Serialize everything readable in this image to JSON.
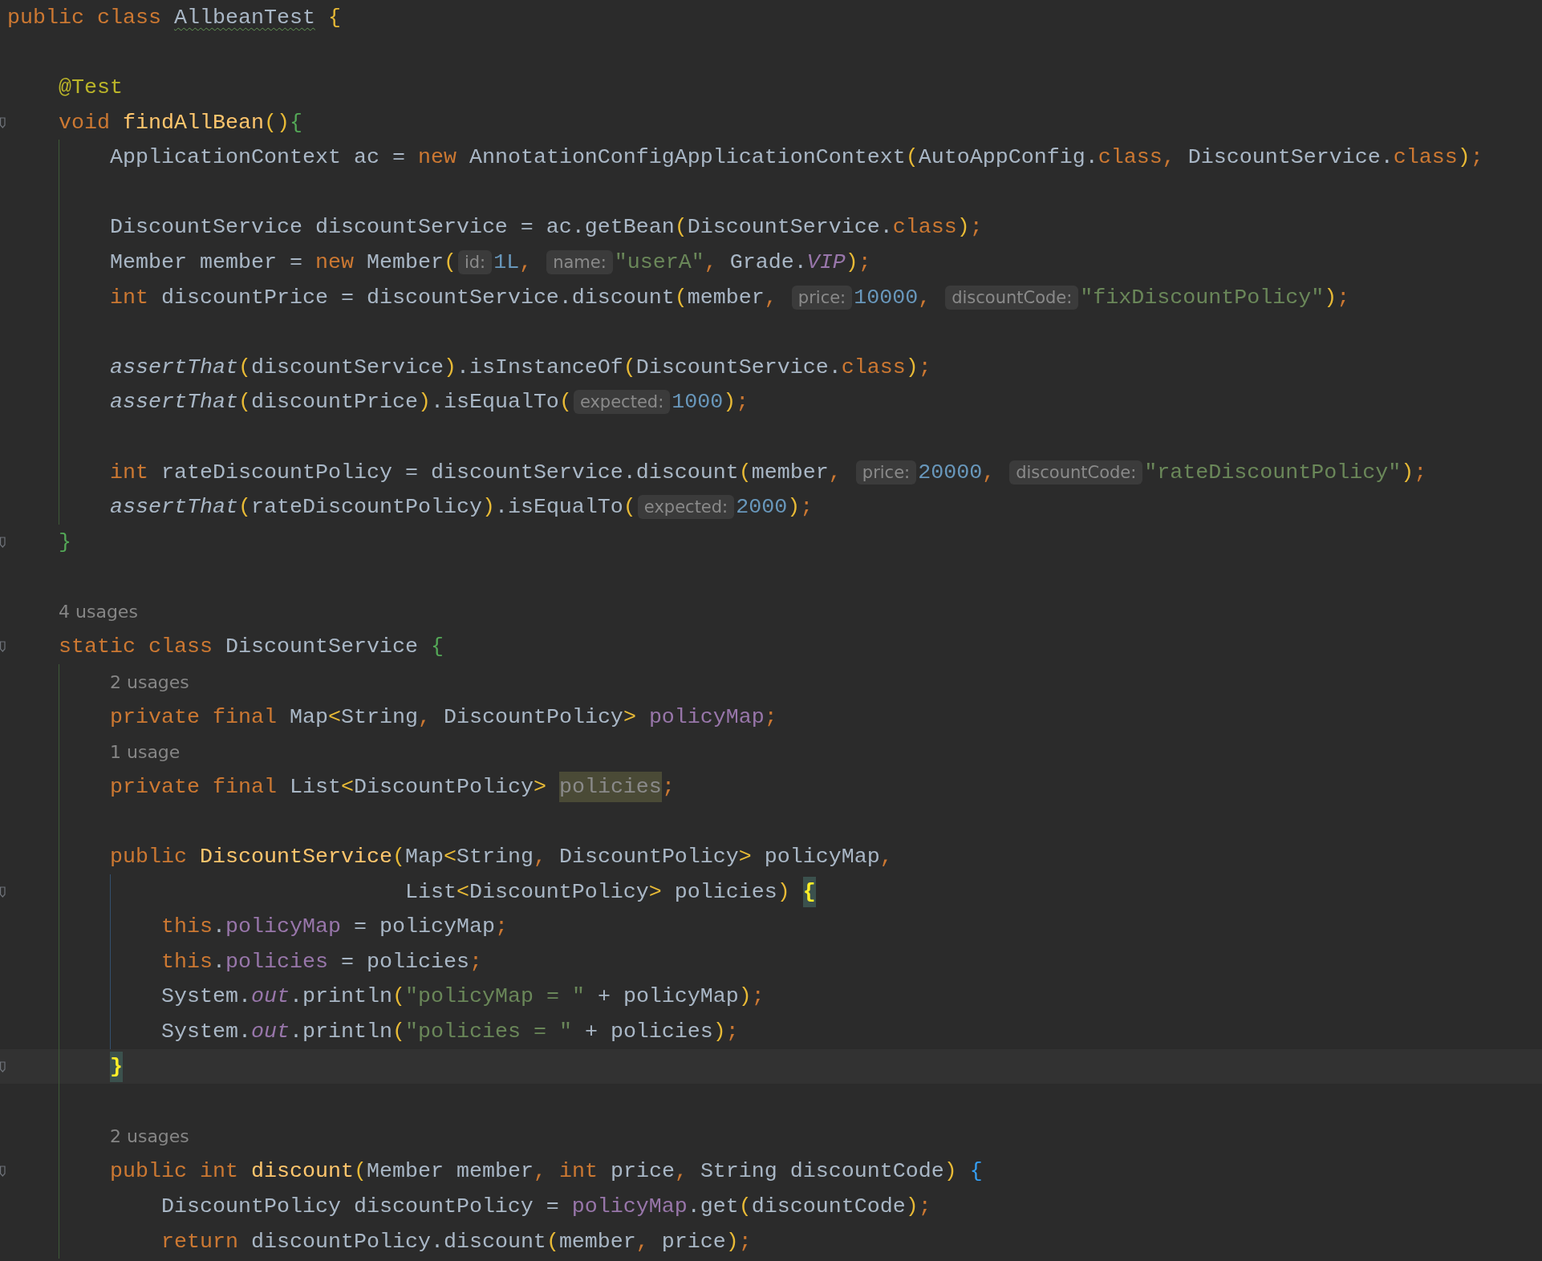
{
  "editor": {
    "lines": [
      {
        "kind": "code",
        "tokens": [
          {
            "text": "public class ",
            "kind": "kw"
          },
          {
            "text": "AllbeanTest",
            "kind": "typo"
          },
          {
            "text": " {",
            "kind": "p1"
          }
        ]
      },
      {
        "kind": "blank"
      },
      {
        "kind": "code",
        "tokens": [
          {
            "text": "    @Test",
            "kind": "ann"
          }
        ]
      },
      {
        "kind": "code",
        "fold": true,
        "tokens": [
          {
            "text": "    void ",
            "kind": "kw"
          },
          {
            "text": "findAllBean",
            "kind": "decl"
          },
          {
            "text": "()",
            "kind": "p1"
          },
          {
            "text": "{",
            "kind": "p2"
          }
        ]
      },
      {
        "kind": "code",
        "tokens": [
          {
            "text": "        ApplicationContext ac = ",
            "kind": "plain"
          },
          {
            "text": "new ",
            "kind": "kw"
          },
          {
            "text": "AnnotationConfigApplicationContext",
            "kind": "plain"
          },
          {
            "text": "(",
            "kind": "p1"
          },
          {
            "text": "AutoAppConfig.",
            "kind": "plain"
          },
          {
            "text": "class",
            "kind": "kw"
          },
          {
            "text": ", ",
            "kind": "punct"
          },
          {
            "text": "DiscountService.",
            "kind": "plain"
          },
          {
            "text": "class",
            "kind": "kw"
          },
          {
            "text": ")",
            "kind": "p1"
          },
          {
            "text": ";",
            "kind": "punct"
          }
        ]
      },
      {
        "kind": "blank"
      },
      {
        "kind": "code",
        "tokens": [
          {
            "text": "        DiscountService discountService = ac.getBean",
            "kind": "plain"
          },
          {
            "text": "(",
            "kind": "p1"
          },
          {
            "text": "DiscountService.",
            "kind": "plain"
          },
          {
            "text": "class",
            "kind": "kw"
          },
          {
            "text": ")",
            "kind": "p1"
          },
          {
            "text": ";",
            "kind": "punct"
          }
        ]
      },
      {
        "kind": "code",
        "tokens": [
          {
            "text": "        Member member = ",
            "kind": "plain"
          },
          {
            "text": "new ",
            "kind": "kw"
          },
          {
            "text": "Member",
            "kind": "plain"
          },
          {
            "text": "(",
            "kind": "p1"
          },
          {
            "text": "id:",
            "kind": "hint"
          },
          {
            "text": "1L",
            "kind": "num"
          },
          {
            "text": ", ",
            "kind": "punct"
          },
          {
            "text": "name:",
            "kind": "hint"
          },
          {
            "text": "\"userA\"",
            "kind": "str"
          },
          {
            "text": ", ",
            "kind": "punct"
          },
          {
            "text": "Grade.",
            "kind": "plain"
          },
          {
            "text": "VIP",
            "kind": "static"
          },
          {
            "text": ")",
            "kind": "p1"
          },
          {
            "text": ";",
            "kind": "punct"
          }
        ]
      },
      {
        "kind": "code",
        "tokens": [
          {
            "text": "        int ",
            "kind": "kw"
          },
          {
            "text": "discountPrice = discountService.discount",
            "kind": "plain"
          },
          {
            "text": "(",
            "kind": "p1"
          },
          {
            "text": "member",
            "kind": "plain"
          },
          {
            "text": ", ",
            "kind": "punct"
          },
          {
            "text": "price:",
            "kind": "hint"
          },
          {
            "text": "10000",
            "kind": "num"
          },
          {
            "text": ", ",
            "kind": "punct"
          },
          {
            "text": "discountCode:",
            "kind": "hint"
          },
          {
            "text": "\"fixDiscountPolicy\"",
            "kind": "str"
          },
          {
            "text": ")",
            "kind": "p1"
          },
          {
            "text": ";",
            "kind": "punct"
          }
        ]
      },
      {
        "kind": "blank"
      },
      {
        "kind": "code",
        "tokens": [
          {
            "text": "        assertThat",
            "kind": "ital"
          },
          {
            "text": "(",
            "kind": "p1"
          },
          {
            "text": "discountService",
            "kind": "plain"
          },
          {
            "text": ")",
            "kind": "p1"
          },
          {
            "text": ".isInstanceOf",
            "kind": "plain"
          },
          {
            "text": "(",
            "kind": "p1"
          },
          {
            "text": "DiscountService.",
            "kind": "plain"
          },
          {
            "text": "class",
            "kind": "kw"
          },
          {
            "text": ")",
            "kind": "p1"
          },
          {
            "text": ";",
            "kind": "punct"
          }
        ]
      },
      {
        "kind": "code",
        "tokens": [
          {
            "text": "        assertThat",
            "kind": "ital"
          },
          {
            "text": "(",
            "kind": "p1"
          },
          {
            "text": "discountPrice",
            "kind": "plain"
          },
          {
            "text": ")",
            "kind": "p1"
          },
          {
            "text": ".isEqualTo",
            "kind": "plain"
          },
          {
            "text": "(",
            "kind": "p1"
          },
          {
            "text": "expected:",
            "kind": "hint"
          },
          {
            "text": "1000",
            "kind": "num"
          },
          {
            "text": ")",
            "kind": "p1"
          },
          {
            "text": ";",
            "kind": "punct"
          }
        ]
      },
      {
        "kind": "blank"
      },
      {
        "kind": "code",
        "tokens": [
          {
            "text": "        int ",
            "kind": "kw"
          },
          {
            "text": "rateDiscountPolicy = discountService.discount",
            "kind": "plain"
          },
          {
            "text": "(",
            "kind": "p1"
          },
          {
            "text": "member",
            "kind": "plain"
          },
          {
            "text": ", ",
            "kind": "punct"
          },
          {
            "text": "price:",
            "kind": "hint"
          },
          {
            "text": "20000",
            "kind": "num"
          },
          {
            "text": ", ",
            "kind": "punct"
          },
          {
            "text": "discountCode:",
            "kind": "hint"
          },
          {
            "text": "\"rateDiscountPolicy\"",
            "kind": "str"
          },
          {
            "text": ")",
            "kind": "p1"
          },
          {
            "text": ";",
            "kind": "punct"
          }
        ]
      },
      {
        "kind": "code",
        "tokens": [
          {
            "text": "        assertThat",
            "kind": "ital"
          },
          {
            "text": "(",
            "kind": "p1"
          },
          {
            "text": "rateDiscountPolicy",
            "kind": "plain"
          },
          {
            "text": ")",
            "kind": "p1"
          },
          {
            "text": ".isEqualTo",
            "kind": "plain"
          },
          {
            "text": "(",
            "kind": "p1"
          },
          {
            "text": "expected:",
            "kind": "hint"
          },
          {
            "text": "2000",
            "kind": "num"
          },
          {
            "text": ")",
            "kind": "p1"
          },
          {
            "text": ";",
            "kind": "punct"
          }
        ]
      },
      {
        "kind": "code",
        "fold": true,
        "tokens": [
          {
            "text": "    }",
            "kind": "p2"
          }
        ]
      },
      {
        "kind": "blank"
      },
      {
        "kind": "usages",
        "text": "    4 usages"
      },
      {
        "kind": "code",
        "fold": true,
        "tokens": [
          {
            "text": "    static class ",
            "kind": "kw"
          },
          {
            "text": "DiscountService ",
            "kind": "plain"
          },
          {
            "text": "{",
            "kind": "p2"
          }
        ]
      },
      {
        "kind": "usages",
        "text": "        2 usages"
      },
      {
        "kind": "code",
        "tokens": [
          {
            "text": "        private final ",
            "kind": "kw"
          },
          {
            "text": "Map",
            "kind": "plain"
          },
          {
            "text": "<",
            "kind": "p1"
          },
          {
            "text": "String",
            "kind": "plain"
          },
          {
            "text": ", ",
            "kind": "punct"
          },
          {
            "text": "DiscountPolicy",
            "kind": "plain"
          },
          {
            "text": "> ",
            "kind": "p1"
          },
          {
            "text": "policyMap",
            "kind": "field"
          },
          {
            "text": ";",
            "kind": "punct"
          }
        ]
      },
      {
        "kind": "usages",
        "text": "        1 usage"
      },
      {
        "kind": "code",
        "tokens": [
          {
            "text": "        private final ",
            "kind": "kw"
          },
          {
            "text": "List",
            "kind": "plain"
          },
          {
            "text": "<",
            "kind": "p1"
          },
          {
            "text": "DiscountPolicy",
            "kind": "plain"
          },
          {
            "text": "> ",
            "kind": "p1"
          },
          {
            "text": "policies",
            "kind": "usage"
          },
          {
            "text": ";",
            "kind": "punct"
          }
        ]
      },
      {
        "kind": "blank"
      },
      {
        "kind": "code",
        "tokens": [
          {
            "text": "        public ",
            "kind": "kw"
          },
          {
            "text": "DiscountService",
            "kind": "decl"
          },
          {
            "text": "(",
            "kind": "p1"
          },
          {
            "text": "Map",
            "kind": "plain"
          },
          {
            "text": "<",
            "kind": "p1"
          },
          {
            "text": "String",
            "kind": "plain"
          },
          {
            "text": ", ",
            "kind": "punct"
          },
          {
            "text": "DiscountPolicy",
            "kind": "plain"
          },
          {
            "text": ">",
            "kind": "p1"
          },
          {
            "text": " policyMap",
            "kind": "plain"
          },
          {
            "text": ",",
            "kind": "punct"
          }
        ]
      },
      {
        "kind": "code",
        "fold": true,
        "tokens": [
          {
            "text": "                               List",
            "kind": "plain"
          },
          {
            "text": "<",
            "kind": "p1"
          },
          {
            "text": "DiscountPolicy",
            "kind": "plain"
          },
          {
            "text": ">",
            "kind": "p1"
          },
          {
            "text": " policies",
            "kind": "plain"
          },
          {
            "text": ") ",
            "kind": "p1"
          },
          {
            "text": "{",
            "kind": "match"
          }
        ]
      },
      {
        "kind": "code",
        "tokens": [
          {
            "text": "            this",
            "kind": "kw"
          },
          {
            "text": ".",
            "kind": "plain"
          },
          {
            "text": "policyMap",
            "kind": "field"
          },
          {
            "text": " = policyMap",
            "kind": "plain"
          },
          {
            "text": ";",
            "kind": "punct"
          }
        ]
      },
      {
        "kind": "code",
        "tokens": [
          {
            "text": "            this",
            "kind": "kw"
          },
          {
            "text": ".",
            "kind": "plain"
          },
          {
            "text": "policies",
            "kind": "field"
          },
          {
            "text": " = policies",
            "kind": "plain"
          },
          {
            "text": ";",
            "kind": "punct"
          }
        ]
      },
      {
        "kind": "code",
        "tokens": [
          {
            "text": "            System.",
            "kind": "plain"
          },
          {
            "text": "out",
            "kind": "static"
          },
          {
            "text": ".println",
            "kind": "plain"
          },
          {
            "text": "(",
            "kind": "p1"
          },
          {
            "text": "\"policyMap = \"",
            "kind": "str"
          },
          {
            "text": " + policyMap",
            "kind": "plain"
          },
          {
            "text": ")",
            "kind": "p1"
          },
          {
            "text": ";",
            "kind": "punct"
          }
        ]
      },
      {
        "kind": "code",
        "tokens": [
          {
            "text": "            System.",
            "kind": "plain"
          },
          {
            "text": "out",
            "kind": "static"
          },
          {
            "text": ".println",
            "kind": "plain"
          },
          {
            "text": "(",
            "kind": "p1"
          },
          {
            "text": "\"policies = \"",
            "kind": "str"
          },
          {
            "text": " + policies",
            "kind": "plain"
          },
          {
            "text": ")",
            "kind": "p1"
          },
          {
            "text": ";",
            "kind": "punct"
          }
        ]
      },
      {
        "kind": "code",
        "fold": true,
        "current": true,
        "tokens": [
          {
            "text": "        }",
            "kind": "match"
          }
        ]
      },
      {
        "kind": "blank"
      },
      {
        "kind": "usages",
        "text": "        2 usages"
      },
      {
        "kind": "code",
        "fold": true,
        "tokens": [
          {
            "text": "        public int ",
            "kind": "kw"
          },
          {
            "text": "discount",
            "kind": "decl"
          },
          {
            "text": "(",
            "kind": "p1"
          },
          {
            "text": "Member member",
            "kind": "plain"
          },
          {
            "text": ", ",
            "kind": "punct"
          },
          {
            "text": "int ",
            "kind": "kw"
          },
          {
            "text": "price",
            "kind": "plain"
          },
          {
            "text": ", ",
            "kind": "punct"
          },
          {
            "text": "String discountCode",
            "kind": "plain"
          },
          {
            "text": ") ",
            "kind": "p1"
          },
          {
            "text": "{",
            "kind": "p3"
          }
        ]
      },
      {
        "kind": "code",
        "tokens": [
          {
            "text": "            DiscountPolicy discountPolicy = ",
            "kind": "plain"
          },
          {
            "text": "policyMap",
            "kind": "field"
          },
          {
            "text": ".get",
            "kind": "plain"
          },
          {
            "text": "(",
            "kind": "p1"
          },
          {
            "text": "discountCode",
            "kind": "plain"
          },
          {
            "text": ")",
            "kind": "p1"
          },
          {
            "text": ";",
            "kind": "punct"
          }
        ]
      },
      {
        "kind": "code",
        "tokens": [
          {
            "text": "            return ",
            "kind": "kw"
          },
          {
            "text": "discountPolicy.discount",
            "kind": "plain"
          },
          {
            "text": "(",
            "kind": "p1"
          },
          {
            "text": "member",
            "kind": "plain"
          },
          {
            "text": ", ",
            "kind": "punct"
          },
          {
            "text": "price",
            "kind": "plain"
          },
          {
            "text": ")",
            "kind": "p1"
          },
          {
            "text": ";",
            "kind": "punct"
          }
        ]
      }
    ]
  }
}
